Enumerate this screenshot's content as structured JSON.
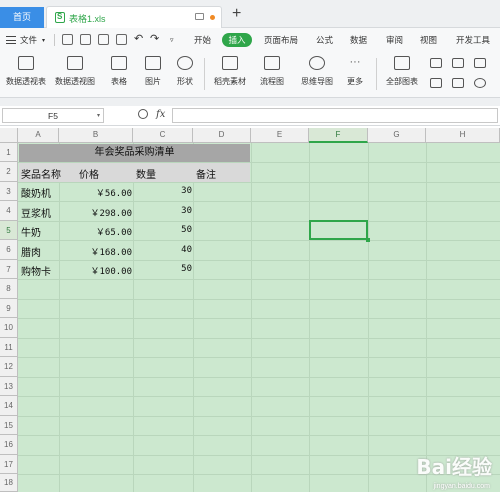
{
  "tabs": {
    "home": "首页",
    "document": "表格1.xls"
  },
  "menu": {
    "file": "文件",
    "tabs": [
      "开始",
      "插入",
      "页面布局",
      "公式",
      "数据",
      "审阅",
      "视图",
      "开发工具"
    ],
    "active_tab": "插入"
  },
  "ribbon": {
    "items": [
      "数据透视表",
      "数据透视图",
      "表格",
      "图片",
      "形状",
      "稻壳素材",
      "流程图",
      "思维导图",
      "更多",
      "全部图表"
    ]
  },
  "formula_bar": {
    "name_box": "F5",
    "fx": "fx",
    "formula": ""
  },
  "sheet": {
    "columns": [
      "A",
      "B",
      "C",
      "D",
      "E",
      "F",
      "G",
      "H"
    ],
    "selected_column": "F",
    "rows": [
      "1",
      "2",
      "3",
      "4",
      "5",
      "6",
      "7",
      "8",
      "9",
      "10",
      "11",
      "12",
      "13",
      "14",
      "15",
      "16",
      "17",
      "18"
    ],
    "selected_row": "5",
    "title": "年会奖品采购清单",
    "headers": [
      "奖品名称",
      "价格",
      "数量",
      "备注"
    ],
    "data": [
      {
        "name": "酸奶机",
        "price": "￥56.00",
        "qty": "30"
      },
      {
        "name": "豆浆机",
        "price": "￥298.00",
        "qty": "30"
      },
      {
        "name": "牛奶",
        "price": "￥65.00",
        "qty": "50"
      },
      {
        "name": "腊肉",
        "price": "￥168.00",
        "qty": "40"
      },
      {
        "name": "购物卡",
        "price": "￥100.00",
        "qty": "50"
      }
    ]
  },
  "colors": {
    "sheet_background": "#cce8cf",
    "accent": "#2fa64a",
    "home_tab": "#3a8ee6"
  },
  "watermark": {
    "brand": "Bai经验",
    "url": "jingyan.baidu.com"
  }
}
